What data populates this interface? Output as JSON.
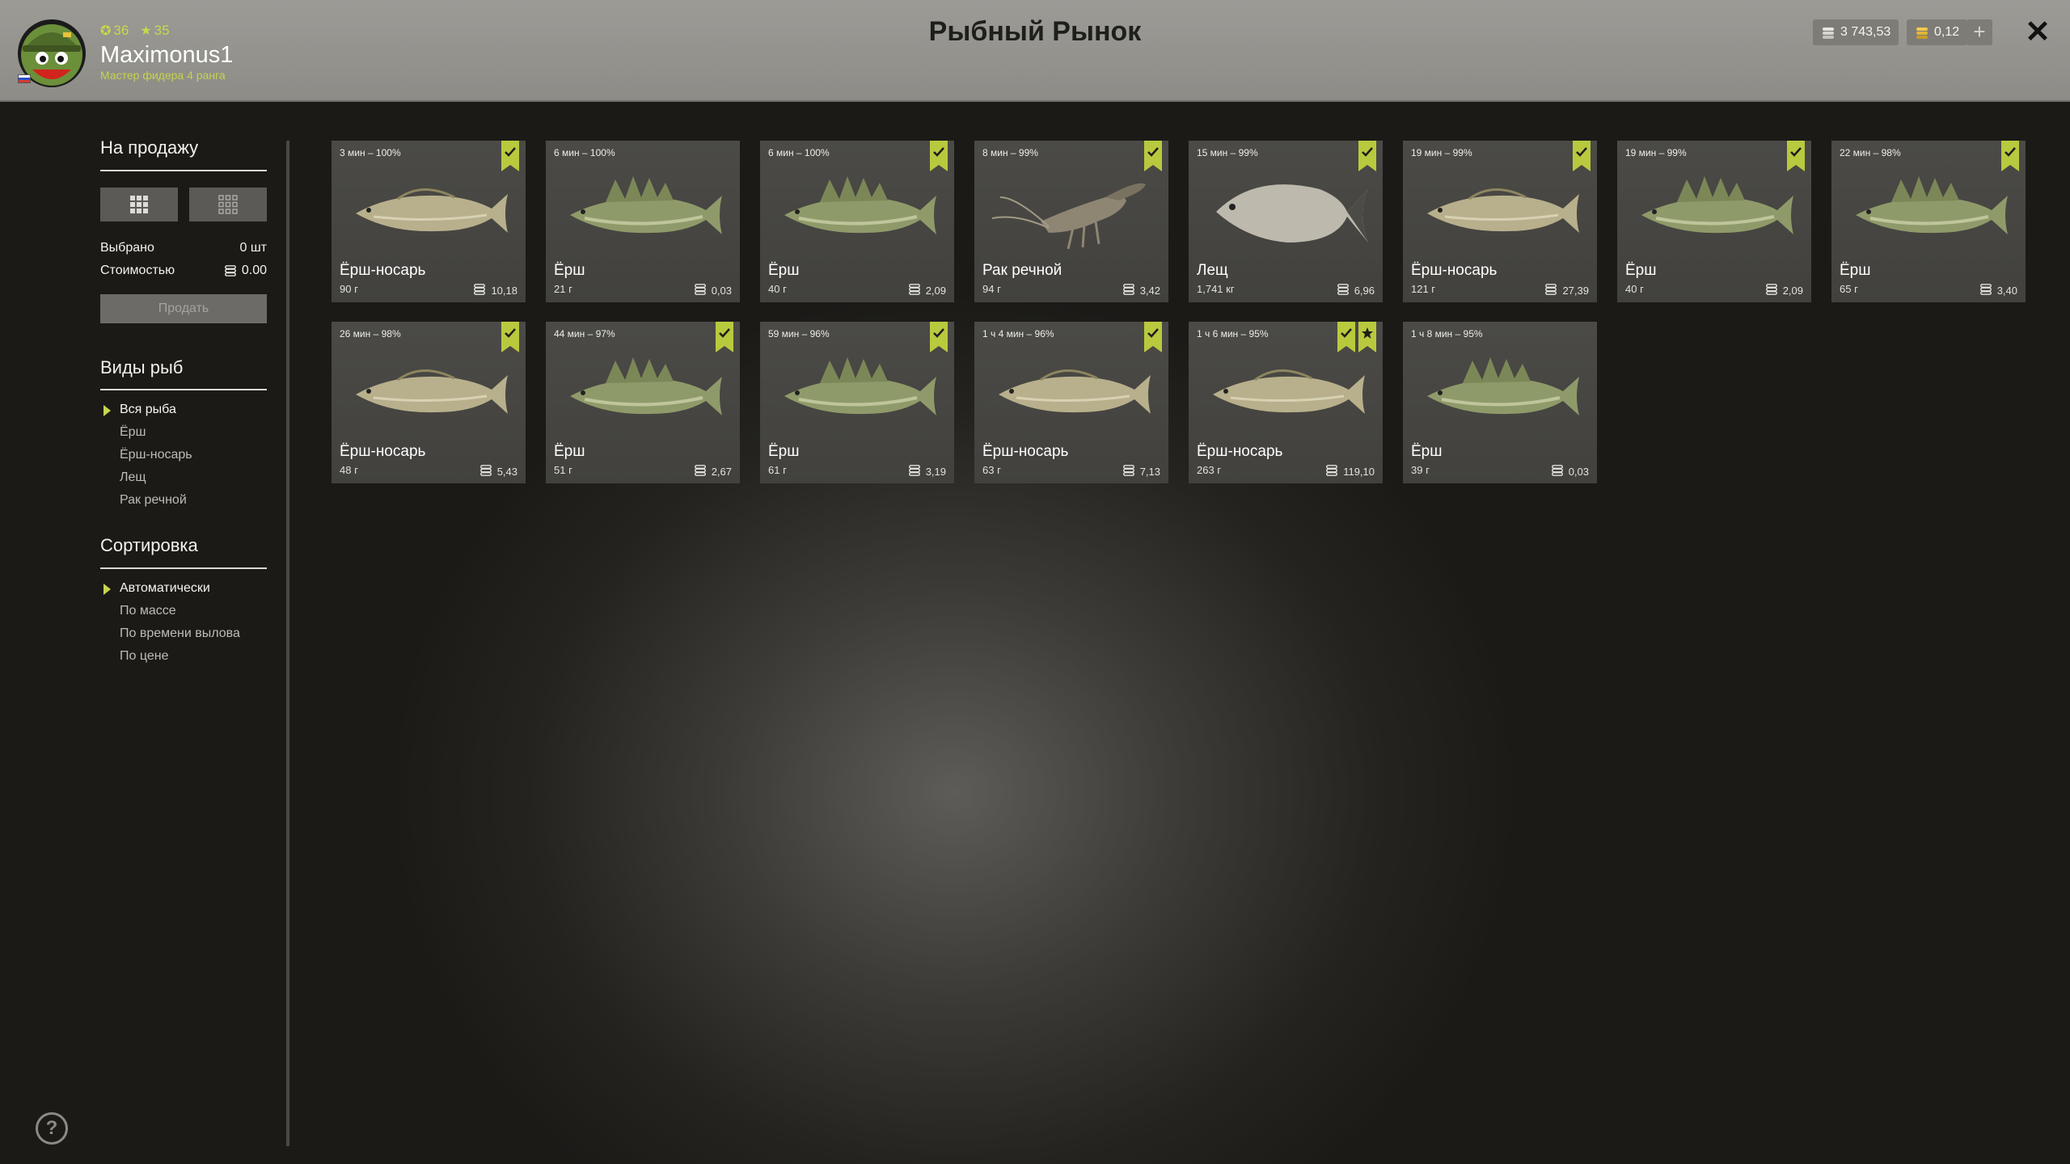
{
  "header": {
    "title": "Рыбный Рынок",
    "level_stat": "36",
    "rank_stat": "35",
    "username": "Maximonus1",
    "rank_text": "Мастер фидера 4 ранга",
    "silver": "3 743,53",
    "gold": "0,12"
  },
  "sidebar": {
    "for_sale_title": "На продажу",
    "selected_label": "Выбрано",
    "selected_value": "0 шт",
    "cost_label": "Стоимостью",
    "cost_value": "0.00",
    "sell_button": "Продать",
    "fish_types_title": "Виды рыб",
    "fish_types": [
      "Вся рыба",
      "Ёрш",
      "Ёрш-носарь",
      "Лещ",
      "Рак речной"
    ],
    "sort_title": "Сортировка",
    "sort_options": [
      "Автоматически",
      "По массе",
      "По времени вылова",
      "По цене"
    ],
    "help_label": "?"
  },
  "colors": {
    "accent": "#c8d64b",
    "badge": "#b9c93e",
    "card_bg": "#4b4a46",
    "header_bg": "#9c9b96"
  },
  "cards": [
    {
      "meta": "3 мин – 100%",
      "name": "Ёрш-носарь",
      "weight": "90 г",
      "price": "10,18",
      "kind": "fish-pale",
      "badges": [
        "check"
      ]
    },
    {
      "meta": "6 мин – 100%",
      "name": "Ёрш",
      "weight": "21 г",
      "price": "0,03",
      "kind": "fish-ruffe",
      "badges": []
    },
    {
      "meta": "6 мин – 100%",
      "name": "Ёрш",
      "weight": "40 г",
      "price": "2,09",
      "kind": "fish-ruffe",
      "badges": [
        "check"
      ]
    },
    {
      "meta": "8 мин – 99%",
      "name": "Рак речной",
      "weight": "94 г",
      "price": "3,42",
      "kind": "crayfish",
      "badges": [
        "check"
      ]
    },
    {
      "meta": "15 мин – 99%",
      "name": "Лещ",
      "weight": "1,741 кг",
      "price": "6,96",
      "kind": "bream",
      "badges": [
        "check"
      ]
    },
    {
      "meta": "19 мин – 99%",
      "name": "Ёрш-носарь",
      "weight": "121 г",
      "price": "27,39",
      "kind": "fish-pale",
      "badges": [
        "check"
      ]
    },
    {
      "meta": "19 мин – 99%",
      "name": "Ёрш",
      "weight": "40 г",
      "price": "2,09",
      "kind": "fish-ruffe",
      "badges": [
        "check"
      ]
    },
    {
      "meta": "22 мин – 98%",
      "name": "Ёрш",
      "weight": "65 г",
      "price": "3,40",
      "kind": "fish-ruffe",
      "badges": [
        "check"
      ]
    },
    {
      "meta": "26 мин – 98%",
      "name": "Ёрш-носарь",
      "weight": "48 г",
      "price": "5,43",
      "kind": "fish-pale",
      "badges": [
        "check"
      ]
    },
    {
      "meta": "44 мин – 97%",
      "name": "Ёрш",
      "weight": "51 г",
      "price": "2,67",
      "kind": "fish-ruffe",
      "badges": [
        "check"
      ]
    },
    {
      "meta": "59 мин – 96%",
      "name": "Ёрш",
      "weight": "61 г",
      "price": "3,19",
      "kind": "fish-ruffe",
      "badges": [
        "check"
      ]
    },
    {
      "meta": "1 ч 4 мин – 96%",
      "name": "Ёрш-носарь",
      "weight": "63 г",
      "price": "7,13",
      "kind": "fish-pale",
      "badges": [
        "check"
      ]
    },
    {
      "meta": "1 ч 6 мин – 95%",
      "name": "Ёрш-носарь",
      "weight": "263 г",
      "price": "119,10",
      "kind": "fish-pale",
      "badges": [
        "check",
        "star"
      ]
    },
    {
      "meta": "1 ч 8 мин – 95%",
      "name": "Ёрш",
      "weight": "39 г",
      "price": "0,03",
      "kind": "fish-ruffe",
      "badges": []
    }
  ]
}
